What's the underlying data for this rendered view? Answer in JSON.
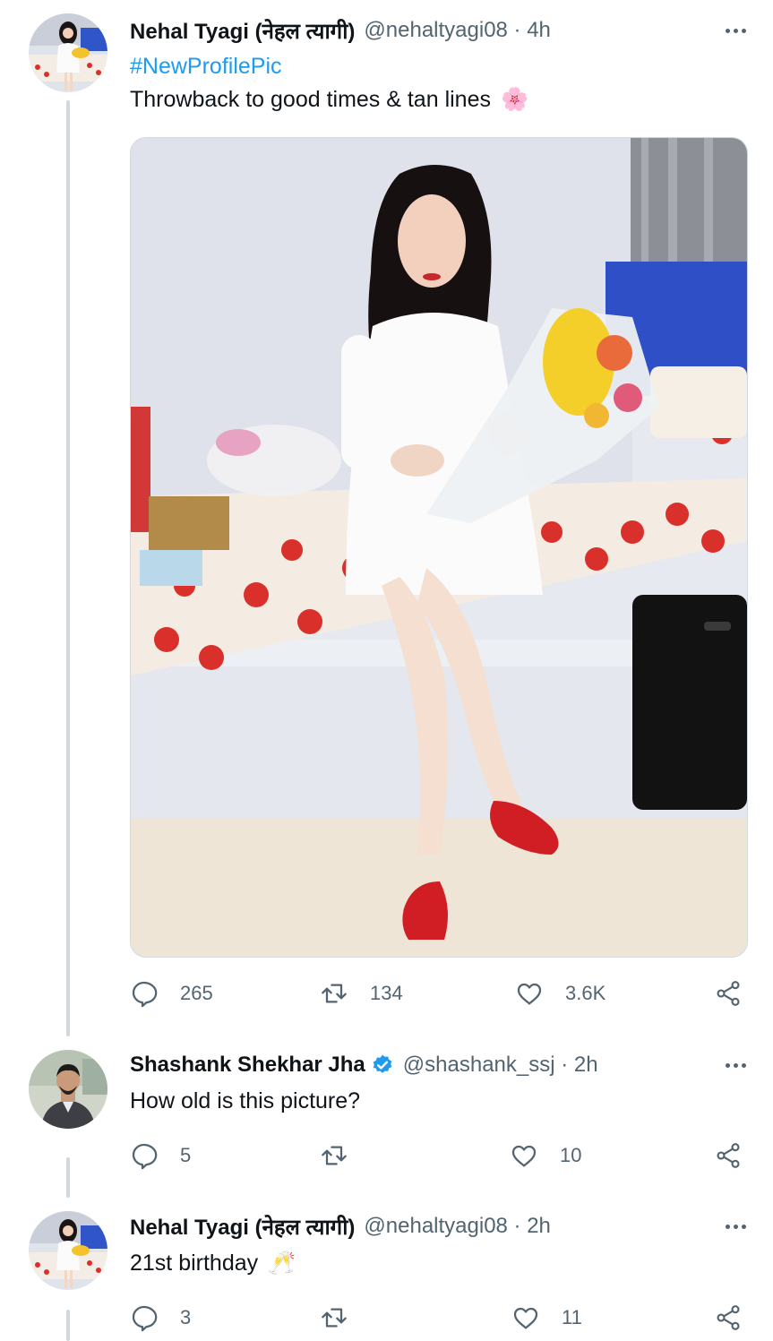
{
  "tweets": [
    {
      "author_name": "Nehal Tyagi (नेहल त्यागी)",
      "handle_time": "@nehaltyagi08 · 4h",
      "hashtag": "#NewProfilePic",
      "text": "Throwback to good times & tan lines",
      "text_emoji": "🌸",
      "replies": "265",
      "retweets": "134",
      "likes": "3.6K"
    },
    {
      "author_name": "Shashank Shekhar Jha",
      "verified": true,
      "handle_time": "@shashank_ssj · 2h",
      "text": "How old is this picture?",
      "replies": "5",
      "retweets": "",
      "likes": "10"
    },
    {
      "author_name": "Nehal Tyagi (नेहल त्यागी)",
      "handle_time": "@nehaltyagi08 · 2h",
      "text": "21st birthday",
      "text_emoji": "🥂",
      "replies": "3",
      "retweets": "",
      "likes": "11"
    }
  ],
  "icons": {
    "reply": "reply-icon",
    "retweet": "retweet-icon",
    "like": "heart-icon",
    "share": "share-icon",
    "more": "more-icon",
    "verified": "verified-badge-icon"
  },
  "colors": {
    "accent": "#1d9bf0",
    "text_secondary": "#536471",
    "thread_line": "#cfd9de"
  }
}
